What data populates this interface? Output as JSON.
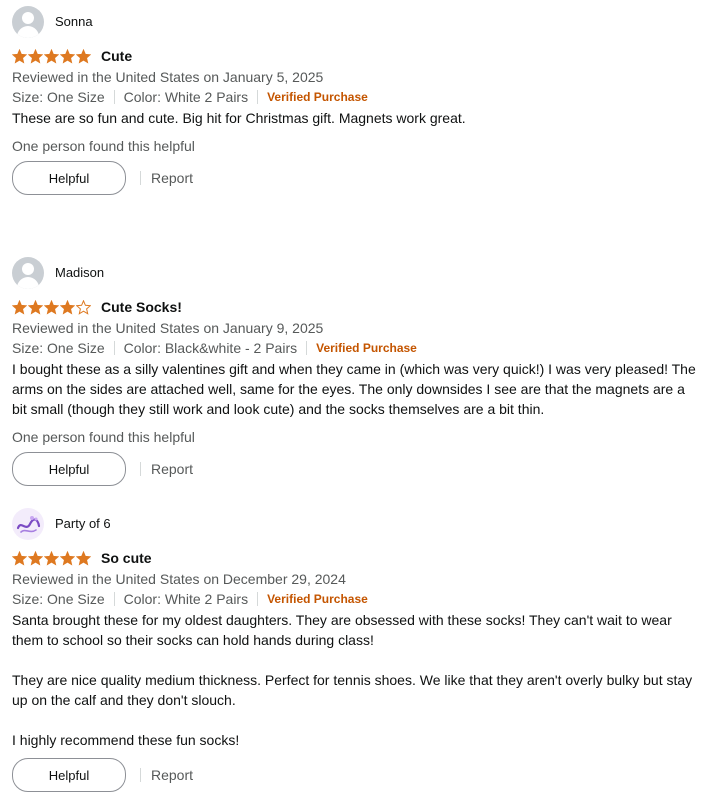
{
  "reviews": [
    {
      "profile_name": "Sonna",
      "avatar": "default-avatar-icon",
      "rating": 5,
      "title": "Cute",
      "date": "Reviewed in the United States on January 5, 2025",
      "size": "Size: One Size",
      "color": "Color: White 2 Pairs",
      "verified": "Verified Purchase",
      "body": [
        "These are so fun and cute. Big hit for Christmas gift. Magnets work great."
      ],
      "helpful_text": "One person found this helpful",
      "helpful_label": "Helpful",
      "report_label": "Report"
    },
    {
      "profile_name": "Madison",
      "avatar": "default-avatar-icon",
      "rating": 4,
      "title": "Cute Socks!",
      "date": "Reviewed in the United States on January 9, 2025",
      "size": "Size: One Size",
      "color": "Color: Black&white - 2 Pairs",
      "verified": "Verified Purchase",
      "body": [
        "I bought these as a silly valentines gift and when they came in (which was very quick!) I was very pleased! The arms on the sides are attached well, same for the eyes. The only downsides I see are that the magnets are a bit small (though they still work and look cute) and the socks themselves are a bit thin."
      ],
      "helpful_text": "One person found this helpful",
      "helpful_label": "Helpful",
      "report_label": "Report"
    },
    {
      "profile_name": "Party of 6",
      "avatar": "custom-logo-avatar-icon",
      "rating": 5,
      "title": "So cute",
      "date": "Reviewed in the United States on December 29, 2024",
      "size": "Size: One Size",
      "color": "Color: White 2 Pairs",
      "verified": "Verified Purchase",
      "body": [
        "Santa brought these for my oldest daughters. They are obsessed with these socks! They can't wait to wear them to school so their socks can hold hands during class!",
        "They are nice quality medium thickness. Perfect for tennis shoes. We like that they aren't overly bulky but stay up on the calf and they don't slouch.",
        "I highly recommend these fun socks!"
      ],
      "helpful_text": "",
      "helpful_label": "Helpful",
      "report_label": "Report"
    }
  ],
  "colors": {
    "star_fill": "#de7921",
    "star_empty": "#de7921",
    "verified": "#c45500",
    "muted_text": "#565959"
  }
}
